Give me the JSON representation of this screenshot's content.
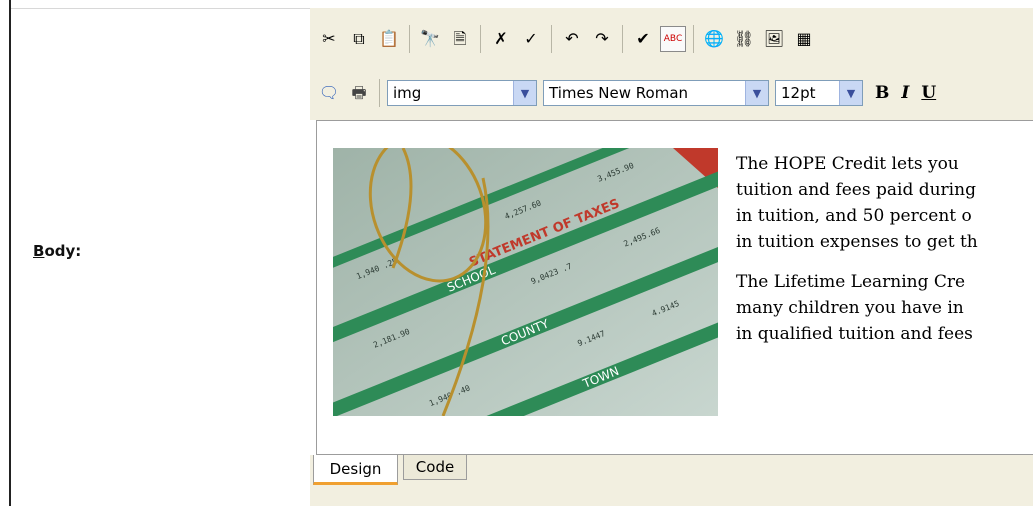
{
  "field": {
    "label_first": "B",
    "label_rest": "ody:"
  },
  "toolbar": {
    "row1": [
      {
        "name": "cut-icon",
        "glyph": "✂"
      },
      {
        "name": "copy-icon",
        "glyph": "⧉"
      },
      {
        "name": "paste-icon",
        "glyph": "📋"
      },
      {
        "sep": true
      },
      {
        "name": "find-icon",
        "glyph": "🔭"
      },
      {
        "name": "properties-icon",
        "glyph": "🗎"
      },
      {
        "sep": true
      },
      {
        "name": "remove-format-icon",
        "glyph": "✗"
      },
      {
        "name": "format-brush-icon",
        "glyph": "✓"
      },
      {
        "sep": true
      },
      {
        "name": "undo-icon",
        "glyph": "↶"
      },
      {
        "name": "redo-icon",
        "glyph": "↷"
      },
      {
        "sep": true
      },
      {
        "name": "spellcheck-icon",
        "glyph": "✔"
      },
      {
        "name": "spellcheck-live-icon",
        "glyph": "ABC",
        "boxed": true
      },
      {
        "sep": true
      },
      {
        "name": "insert-link-icon",
        "glyph": "🌐"
      },
      {
        "name": "cms-link-icon",
        "glyph": "⛓"
      },
      {
        "name": "cms-image-icon",
        "glyph": "🖼"
      },
      {
        "name": "cms-more-icon",
        "glyph": "▦"
      }
    ],
    "row2_icons": [
      {
        "name": "comment-icon",
        "glyph": "🗨"
      },
      {
        "name": "print-icon",
        "glyph": "🖶"
      }
    ],
    "style_select": "img",
    "font_select": "Times New Roman",
    "size_select": "12pt",
    "bold_label": "B",
    "italic_label": "I",
    "underline_label": "U"
  },
  "content": {
    "paragraphs": [
      [
        "The HOPE Credit lets you",
        "tuition and fees paid during",
        "in tuition, and 50 percent o",
        "in tuition expenses to get th"
      ],
      [
        "The Lifetime Learning Cre",
        "many children you have in",
        "in qualified tuition and fees"
      ]
    ],
    "image_alt": "Tax statement with eyeglasses",
    "image_text": {
      "statement": "STATEMENT OF TAXES",
      "school": "SCHOOL",
      "county": "COUNTY",
      "town": "TOWN"
    }
  },
  "tabs": {
    "design": "Design",
    "code": "Code"
  },
  "colors": {
    "toolbar_bg": "#f2efe0",
    "tab_accent": "#f0a030",
    "select_arrow": "#c9d8f4"
  }
}
